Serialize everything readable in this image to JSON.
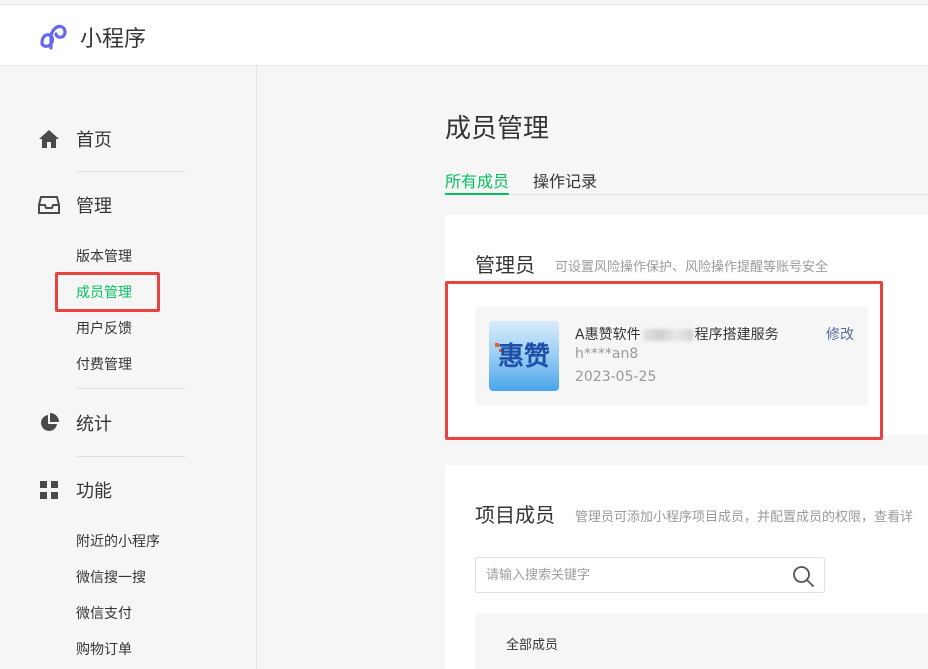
{
  "app": {
    "title": "小程序"
  },
  "sidebar": {
    "home": "首页",
    "manage": {
      "label": "管理",
      "items": [
        "版本管理",
        "成员管理",
        "用户反馈",
        "付费管理"
      ]
    },
    "stats": "统计",
    "features": {
      "label": "功能",
      "items": [
        "附近的小程序",
        "微信搜一搜",
        "微信支付",
        "购物订单"
      ]
    },
    "active_item": "成员管理"
  },
  "page": {
    "title": "成员管理",
    "tabs": [
      "所有成员",
      "操作记录"
    ],
    "active_tab": "所有成员"
  },
  "admin_section": {
    "title": "管理员",
    "description": "可设置风险操作保护、风险操作提醒等账号安全",
    "member": {
      "name_prefix": "A惠赞软件",
      "name_suffix": "程序搭建服务",
      "id": "h****an8",
      "date": "2023-05-25",
      "edit": "修改"
    }
  },
  "project_section": {
    "title": "项目成员",
    "description": "管理员可添加小程序项目成员，并配置成员的权限，查看详",
    "search_placeholder": "请输入搜索关键字",
    "filter_label": "全部成员"
  },
  "colors": {
    "accent": "#07c160",
    "highlight": "#e64340",
    "link": "#576b95"
  }
}
